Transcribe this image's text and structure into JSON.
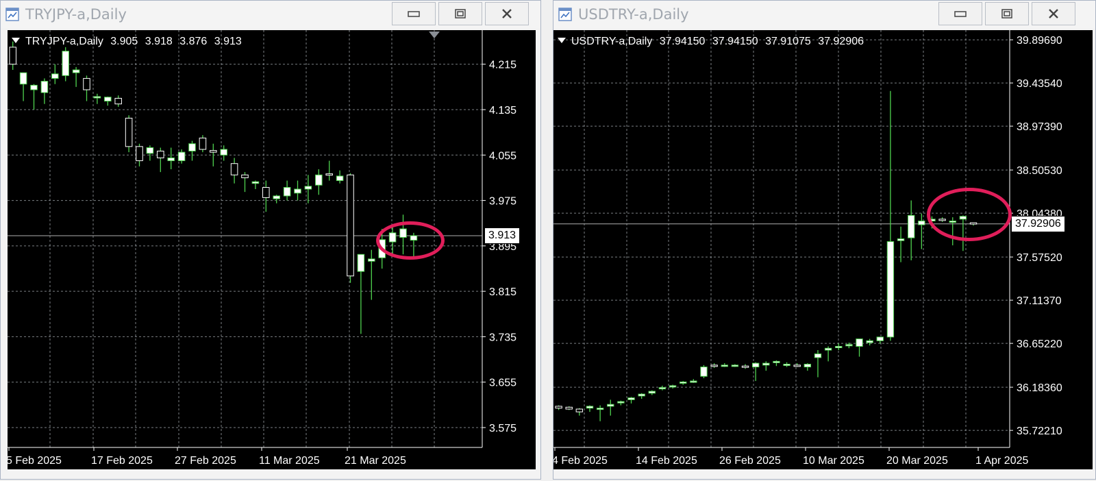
{
  "windows": [
    {
      "id": "left",
      "title": "TRYJPY-a,Daily",
      "info": {
        "symbol": "TRYJPY-a,Daily",
        "open": "3.905",
        "high": "3.918",
        "low": "3.876",
        "close": "3.913"
      },
      "price_label": "3.913",
      "price_axis": [
        "4.215",
        "4.135",
        "4.055",
        "3.975",
        "3.895",
        "3.815",
        "3.735",
        "3.655",
        "3.575"
      ],
      "time_axis": [
        "5 Feb 2025",
        "17 Feb 2025",
        "27 Feb 2025",
        "11 Mar 2025",
        "21 Mar 2025"
      ],
      "buttons": {
        "minimize": "minimize-icon",
        "maximize": "maximize-icon",
        "close": "close-icon"
      }
    },
    {
      "id": "right",
      "title": "USDTRY-a,Daily",
      "info": {
        "symbol": "USDTRY-a,Daily",
        "open": "37.94150",
        "high": "37.94150",
        "low": "37.91075",
        "close": "37.92906"
      },
      "price_label": "37.92906",
      "price_axis": [
        "39.89690",
        "39.43540",
        "38.97390",
        "38.50530",
        "38.04380",
        "37.57520",
        "37.11370",
        "36.65220",
        "36.18360",
        "35.72210"
      ],
      "time_axis": [
        "4 Feb 2025",
        "14 Feb 2025",
        "26 Feb 2025",
        "10 Mar 2025",
        "20 Mar 2025",
        "1 Apr 2025"
      ],
      "buttons": {
        "minimize": "minimize-icon",
        "maximize": "maximize-icon",
        "close": "close-icon"
      }
    }
  ],
  "colors": {
    "bull_body": "#ffffff",
    "wick": "#4fd34f",
    "grid": "#9aa0a6",
    "highlight_ring": "#e01e5a",
    "price_line": "#b0b0b0"
  },
  "chart_data": [
    {
      "type": "candlestick",
      "title": "TRYJPY-a,Daily",
      "x": [
        "2025-02-04",
        "2025-02-05",
        "2025-02-06",
        "2025-02-07",
        "2025-02-10",
        "2025-02-11",
        "2025-02-12",
        "2025-02-13",
        "2025-02-14",
        "2025-02-17",
        "2025-02-18",
        "2025-02-19",
        "2025-02-20",
        "2025-02-21",
        "2025-02-24",
        "2025-02-25",
        "2025-02-26",
        "2025-02-27",
        "2025-02-28",
        "2025-03-03",
        "2025-03-04",
        "2025-03-05",
        "2025-03-06",
        "2025-03-07",
        "2025-03-10",
        "2025-03-11",
        "2025-03-12",
        "2025-03-13",
        "2025-03-14",
        "2025-03-17",
        "2025-03-18",
        "2025-03-19",
        "2025-03-20",
        "2025-03-21",
        "2025-03-24",
        "2025-03-25",
        "2025-03-26",
        "2025-03-27",
        "2025-03-28"
      ],
      "ohlc": [
        [
          4.245,
          4.255,
          4.205,
          4.215
        ],
        [
          4.18,
          4.195,
          4.15,
          4.2
        ],
        [
          4.17,
          4.18,
          4.135,
          4.178
        ],
        [
          4.165,
          4.19,
          4.145,
          4.185
        ],
        [
          4.19,
          4.215,
          4.18,
          4.198
        ],
        [
          4.195,
          4.245,
          4.185,
          4.238
        ],
        [
          4.2,
          4.21,
          4.175,
          4.205
        ],
        [
          4.19,
          4.195,
          4.15,
          4.17
        ],
        [
          4.157,
          4.163,
          4.145,
          4.158
        ],
        [
          4.15,
          4.158,
          4.142,
          4.157
        ],
        [
          4.155,
          4.16,
          4.14,
          4.145
        ],
        [
          4.12,
          4.125,
          4.06,
          4.07
        ],
        [
          4.07,
          4.075,
          4.035,
          4.045
        ],
        [
          4.058,
          4.072,
          4.045,
          4.068
        ],
        [
          4.062,
          4.068,
          4.025,
          4.05
        ],
        [
          4.045,
          4.068,
          4.03,
          4.05
        ],
        [
          4.045,
          4.065,
          4.04,
          4.06
        ],
        [
          4.062,
          4.08,
          4.045,
          4.075
        ],
        [
          4.085,
          4.09,
          4.06,
          4.065
        ],
        [
          4.063,
          4.075,
          4.035,
          4.06
        ],
        [
          4.055,
          4.072,
          4.045,
          4.065
        ],
        [
          4.04,
          4.05,
          4.005,
          4.02
        ],
        [
          4.02,
          4.025,
          3.99,
          4.015
        ],
        [
          4.005,
          4.01,
          3.995,
          4.008
        ],
        [
          3.998,
          4.01,
          3.955,
          3.98
        ],
        [
          3.978,
          3.985,
          3.97,
          3.983
        ],
        [
          3.983,
          4.01,
          3.975,
          3.998
        ],
        [
          3.988,
          4.01,
          3.975,
          3.995
        ],
        [
          3.995,
          4.02,
          3.97,
          4.0
        ],
        [
          4.002,
          4.03,
          3.985,
          4.02
        ],
        [
          4.022,
          4.045,
          4.01,
          4.02
        ],
        [
          4.01,
          4.028,
          4.005,
          4.018
        ],
        [
          4.02,
          4.023,
          3.83,
          3.842
        ],
        [
          3.85,
          3.88,
          3.74,
          3.88
        ],
        [
          3.868,
          3.888,
          3.8,
          3.872
        ],
        [
          3.874,
          3.925,
          3.855,
          3.906
        ],
        [
          3.902,
          3.93,
          3.88,
          3.918
        ],
        [
          3.91,
          3.95,
          3.88,
          3.925
        ],
        [
          3.905,
          3.918,
          3.876,
          3.913
        ]
      ],
      "ylim": [
        3.54,
        4.275
      ],
      "current_price": 3.913
    },
    {
      "type": "candlestick",
      "title": "USDTRY-a,Daily",
      "x": [
        "2025-02-04",
        "2025-02-05",
        "2025-02-06",
        "2025-02-07",
        "2025-02-10",
        "2025-02-11",
        "2025-02-12",
        "2025-02-13",
        "2025-02-14",
        "2025-02-17",
        "2025-02-18",
        "2025-02-19",
        "2025-02-20",
        "2025-02-21",
        "2025-02-24",
        "2025-02-25",
        "2025-02-26",
        "2025-02-27",
        "2025-02-28",
        "2025-03-03",
        "2025-03-04",
        "2025-03-05",
        "2025-03-06",
        "2025-03-07",
        "2025-03-10",
        "2025-03-11",
        "2025-03-12",
        "2025-03-13",
        "2025-03-14",
        "2025-03-17",
        "2025-03-18",
        "2025-03-19",
        "2025-03-20",
        "2025-03-21",
        "2025-03-24",
        "2025-03-25",
        "2025-03-26",
        "2025-03-27",
        "2025-03-28",
        "2025-03-31",
        "2025-04-01"
      ],
      "ohlc": [
        [
          35.98,
          35.99,
          35.94,
          35.96
        ],
        [
          35.97,
          35.98,
          35.94,
          35.95
        ],
        [
          35.95,
          35.96,
          35.88,
          35.92
        ],
        [
          35.96,
          35.99,
          35.92,
          35.98
        ],
        [
          35.95,
          35.99,
          35.82,
          35.96
        ],
        [
          35.98,
          36.05,
          35.88,
          36.0
        ],
        [
          36.02,
          36.04,
          35.99,
          36.03
        ],
        [
          36.05,
          36.08,
          36.01,
          36.07
        ],
        [
          36.09,
          36.12,
          36.06,
          36.11
        ],
        [
          36.12,
          36.15,
          36.1,
          36.14
        ],
        [
          36.17,
          36.2,
          36.15,
          36.18
        ],
        [
          36.19,
          36.21,
          36.17,
          36.2
        ],
        [
          36.23,
          36.25,
          36.21,
          36.24
        ],
        [
          36.25,
          36.27,
          36.23,
          36.25
        ],
        [
          36.3,
          36.42,
          36.28,
          36.4
        ],
        [
          36.42,
          36.44,
          36.39,
          36.41
        ],
        [
          36.42,
          36.44,
          36.4,
          36.42
        ],
        [
          36.41,
          36.43,
          36.4,
          36.42
        ],
        [
          36.41,
          36.43,
          36.38,
          36.4
        ],
        [
          36.4,
          36.45,
          36.25,
          36.44
        ],
        [
          36.42,
          36.46,
          36.36,
          36.44
        ],
        [
          36.45,
          36.47,
          36.41,
          36.46
        ],
        [
          36.42,
          36.45,
          36.4,
          36.43
        ],
        [
          36.42,
          36.44,
          36.4,
          36.41
        ],
        [
          36.4,
          36.44,
          36.36,
          36.43
        ],
        [
          36.5,
          36.58,
          36.29,
          36.54
        ],
        [
          36.58,
          36.62,
          36.46,
          36.6
        ],
        [
          36.61,
          36.65,
          36.58,
          36.62
        ],
        [
          36.63,
          36.66,
          36.6,
          36.64
        ],
        [
          36.62,
          36.7,
          36.51,
          36.7
        ],
        [
          36.66,
          36.7,
          36.63,
          36.68
        ],
        [
          36.68,
          36.72,
          36.65,
          36.72
        ],
        [
          36.72,
          39.35,
          36.68,
          37.74
        ],
        [
          37.75,
          37.9,
          37.52,
          37.77
        ],
        [
          37.78,
          38.18,
          37.54,
          38.02
        ],
        [
          37.92,
          38.04,
          37.66,
          37.96
        ],
        [
          37.96,
          38.01,
          37.88,
          37.98
        ],
        [
          37.98,
          38.0,
          37.95,
          37.97
        ],
        [
          37.95,
          38.0,
          37.7,
          37.96
        ],
        [
          37.98,
          38.02,
          37.64,
          38.01
        ],
        [
          37.9415,
          37.9415,
          37.91075,
          37.92906
        ]
      ],
      "ylim": [
        35.54,
        40.0
      ],
      "current_price": 37.92906
    }
  ]
}
